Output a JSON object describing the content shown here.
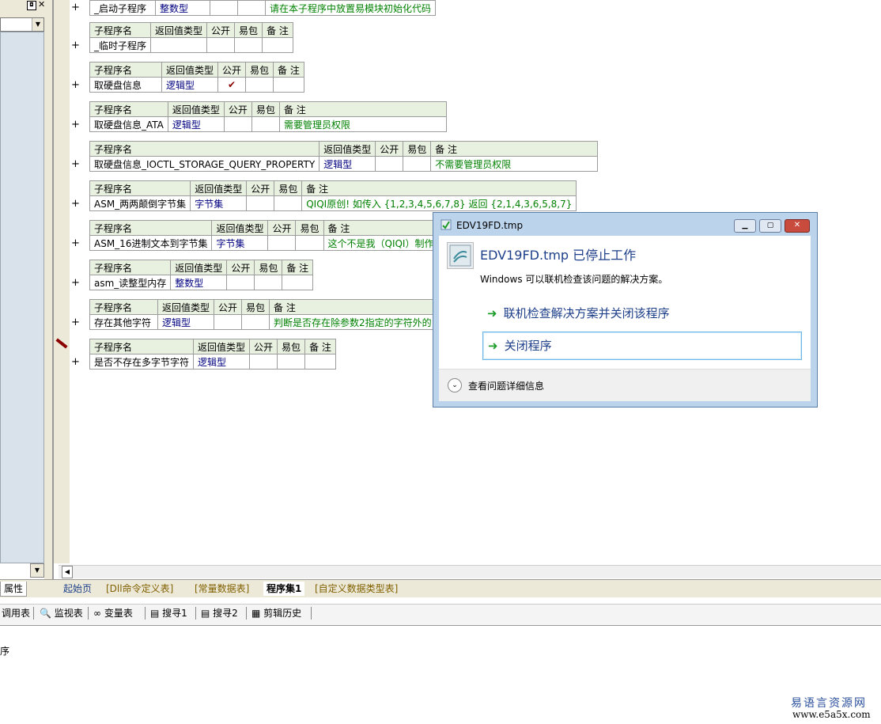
{
  "left_panel": {
    "props_tab": "属性"
  },
  "header_row": [
    "子程序名",
    "返回值类型",
    "公开",
    "易包",
    "备 注"
  ],
  "first_row": {
    "name": "_启动子程序",
    "type": "整数型",
    "pub": "",
    "pkg": "",
    "note": "请在本子程序中放置易模块初始化代码"
  },
  "subs": [
    {
      "name": "_临时子程序",
      "type": "",
      "pub": "",
      "pkg": "",
      "note": ""
    },
    {
      "name": "取硬盘信息",
      "type": "逻辑型",
      "pub": "✔",
      "pkg": "",
      "note": ""
    },
    {
      "name": "取硬盘信息_ATA",
      "type": "逻辑型",
      "pub": "",
      "pkg": "",
      "note": "需要管理员权限"
    },
    {
      "name": "取硬盘信息_IOCTL_STORAGE_QUERY_PROPERTY",
      "type": "逻辑型",
      "pub": "",
      "pkg": "",
      "note": "不需要管理员权限"
    },
    {
      "name": "ASM_两两颠倒字节集",
      "type": "字节集",
      "pub": "",
      "pkg": "",
      "note": "QIQI原创! 如传入 {1,2,3,4,5,6,7,8} 返回 {2,1,4,3,6,5,8,7}"
    },
    {
      "name": "ASM_16进制文本到字节集",
      "type": "字节集",
      "pub": "",
      "pkg": "",
      "note": "这个不是我（QIQI）制作的"
    },
    {
      "name": "asm_读整型内存",
      "type": "整数型",
      "pub": "",
      "pkg": "",
      "note": ""
    },
    {
      "name": "存在其他字符",
      "type": "逻辑型",
      "pub": "",
      "pkg": "",
      "note": "判断是否存在除参数2指定的字符外的"
    },
    {
      "name": "是否不存在多字节字符",
      "type": "逻辑型",
      "pub": "",
      "pkg": "",
      "note": ""
    }
  ],
  "tabs": [
    "起始页",
    "[Dll命令定义表]",
    "[常量数据表]",
    "程序集1",
    "[自定义数据类型表]"
  ],
  "toolbar": [
    "调用表",
    "监视表",
    "变量表",
    "搜寻1",
    "搜寻2",
    "剪辑历史"
  ],
  "dialog": {
    "title": "EDV19FD.tmp",
    "heading": "EDV19FD.tmp 已停止工作",
    "description": "Windows 可以联机检查该问题的解决方案。",
    "option_check": "联机检查解决方案并关闭该程序",
    "option_close": "关闭程序",
    "details": "查看问题详细信息"
  },
  "status_text": "序",
  "watermark": {
    "cn": "易语言资源网",
    "url": "www.e5a5x.com"
  }
}
